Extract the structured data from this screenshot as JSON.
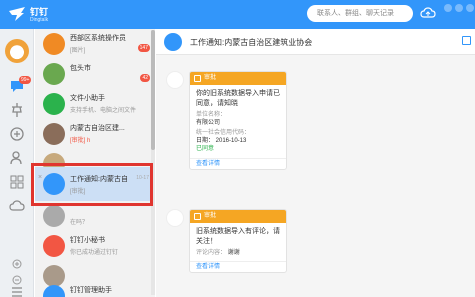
{
  "app": {
    "logo_text": "钉钉",
    "logo_sub": "Dingtalk"
  },
  "search": {
    "placeholder": "联系人、群组、聊天记录"
  },
  "nav": {
    "badge": "99+"
  },
  "conversations": [
    {
      "name": "西部区系统操作员",
      "sub": "[图片]",
      "time": "",
      "badge": "147",
      "color": "#f08a24"
    },
    {
      "name": "包头市",
      "sub": "",
      "time": "",
      "badge": "42",
      "color": "#6aa84f"
    },
    {
      "name": "文件小助手",
      "sub": "支持手机、电脑之间文件",
      "time": "",
      "badge": "",
      "color": "#2bb24c"
    },
    {
      "name": "内蒙古自治区建...",
      "sub": "[审批] h",
      "time": "",
      "badge": "",
      "color": "#8a6d5a"
    },
    {
      "name": "",
      "sub": "",
      "time": "",
      "badge": "",
      "color": "#c7a97c"
    },
    {
      "name": "工作通知:内蒙古自治...",
      "sub": "[审批]",
      "time": "10-17",
      "badge": "",
      "color": "#3296fa"
    },
    {
      "name": "",
      "sub": "在吗？",
      "time": "",
      "badge": "",
      "color": "#aaaaaa"
    },
    {
      "name": "钉钉小秘书",
      "sub": "你已成功通过钉钉",
      "time": "",
      "badge": "",
      "color": "#f25643"
    },
    {
      "name": "",
      "sub": "",
      "time": "",
      "badge": "",
      "color": "#a99a8a"
    },
    {
      "name": "钉钉管理助手",
      "sub": "",
      "time": "",
      "badge": "",
      "color": "#3296fa"
    }
  ],
  "chat": {
    "title": "工作通知:内蒙古自治区建筑业协会",
    "cards": [
      {
        "head": "审批",
        "title": "你的旧系统数据导入申请已同意，请知晓",
        "k1": "单位名称：",
        "v1": "有限公司",
        "k2": "统一社会信用代码：",
        "v2": "日期： 2016-10-13",
        "status": "已同意",
        "foot": "查看详情"
      },
      {
        "head": "审批",
        "title": "旧系统数据导入有评论，请关注！",
        "k1": "评论内容：",
        "v1": "谢谢",
        "foot": "查看详情"
      }
    ]
  }
}
